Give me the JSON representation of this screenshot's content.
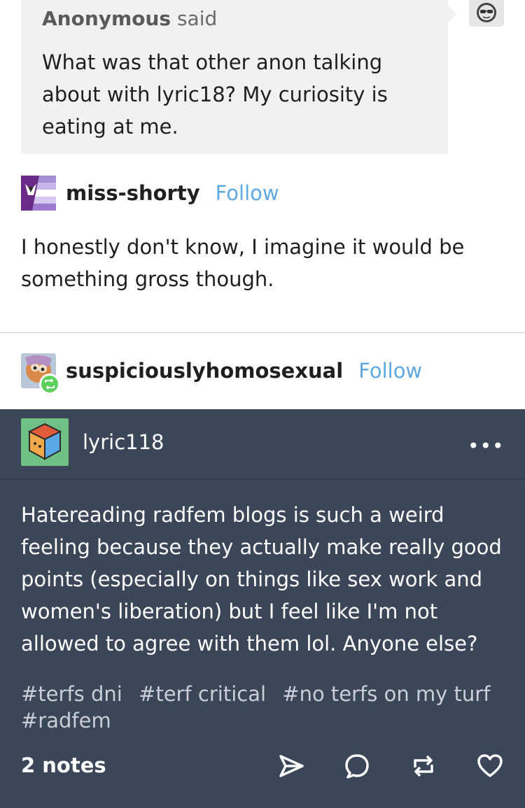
{
  "ask": {
    "asker": "Anonymous",
    "said": "said",
    "question": "What was that other anon talking about with lyric18? My curiosity is eating at me."
  },
  "reply": {
    "username": "miss-shorty",
    "follow_label": "Follow",
    "text": "I honestly don't know, I imagine it would be something gross though."
  },
  "reblogger": {
    "username": "suspiciouslyhomosexual",
    "follow_label": "Follow"
  },
  "original_post": {
    "username": "lyric118",
    "more_label": "•••",
    "body": "Hatereading radfem blogs is such a weird feeling because they actually make really good points (especially on things like sex work and women's liberation) but I feel like I'm not allowed to agree with them lol. Anyone else?",
    "tags": [
      "#terfs dni",
      "#terf critical",
      "#no terfs on my turf",
      "#radfem"
    ],
    "notes": "2 notes"
  },
  "icons": {
    "share": "send-icon",
    "reply": "comment-icon",
    "reblog": "reblog-icon",
    "like": "heart-icon"
  },
  "colors": {
    "dark_bg": "#3b4659",
    "follow": "#5fa8e0",
    "reblog_badge": "#5bd15b",
    "bubble_bg": "#f1f1f1"
  }
}
